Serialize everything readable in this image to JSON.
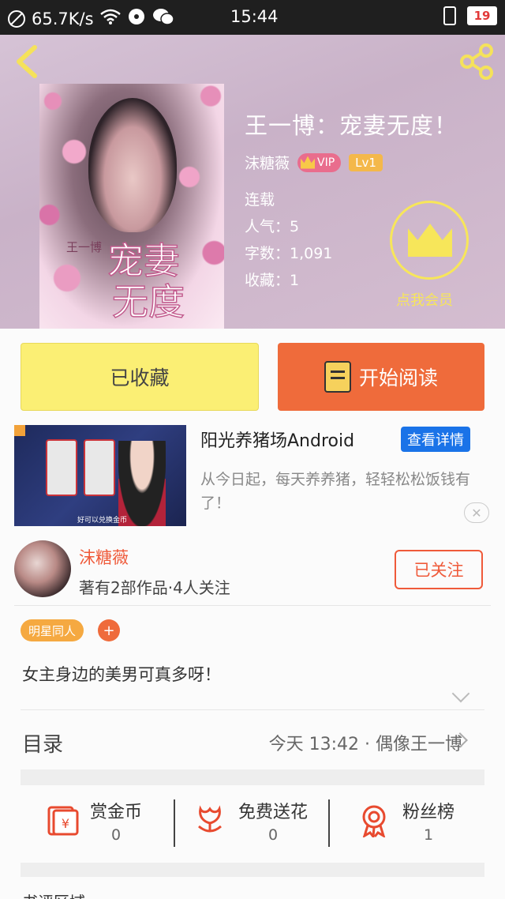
{
  "status_bar": {
    "net_speed": "65.7K/s",
    "time": "15:44",
    "battery": "19",
    "colors": {
      "bg": "#1f1f1f",
      "battery_text": "#e23a3a"
    }
  },
  "header": {
    "back_icon": "back-arrow-icon",
    "share_icon": "share-icon"
  },
  "book": {
    "cover_subtitle": "王一博",
    "cover_title_line1": "宠妻",
    "cover_title_line2": "无度",
    "title": "王一博：宠妻无度！",
    "author": "沫糖薇",
    "vip_label": "VIP",
    "level_label": "Lv1",
    "status": "连载",
    "popularity": "人气：5",
    "word_count": "字数：1,091",
    "favorites": "收藏：1",
    "vip_join_label": "点我会员"
  },
  "actions": {
    "favorited_label": "已收藏",
    "read_label": "开始阅读",
    "colors": {
      "favorited_bg": "#fbef74",
      "read_bg": "#ef6b3b"
    }
  },
  "ad": {
    "image_caption": "好可以兑换金币",
    "title": "阳光养猪场Android",
    "detail_label": "查看详情",
    "description": "从今日起，每天养养猪，轻轻松松饭钱有了！",
    "close_label": "✕"
  },
  "author_card": {
    "name": "沫糖薇",
    "stats": "著有2部作品·4人关注",
    "follow_label": "已关注"
  },
  "tags": {
    "items": [
      "明星同人"
    ],
    "add_label": "+"
  },
  "intro": {
    "text": "女主身边的美男可真多呀！"
  },
  "catalog": {
    "label": "目录",
    "latest": "今天 13:42 · 偶像王一博"
  },
  "stats": [
    {
      "label": "赏金币",
      "value": "0",
      "icon": "red-envelope-icon"
    },
    {
      "label": "免费送花",
      "value": "0",
      "icon": "flower-icon"
    },
    {
      "label": "粉丝榜",
      "value": "1",
      "icon": "medal-icon"
    }
  ],
  "footer_cut": "书评区域"
}
